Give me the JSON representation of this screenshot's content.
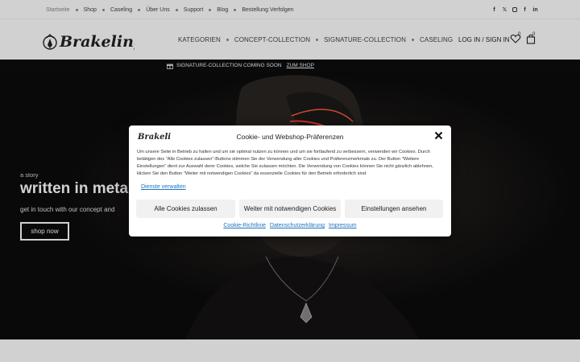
{
  "topbar": {
    "nav": [
      "Startseite",
      "Shop",
      "Caseling",
      "Über Uns",
      "Support",
      "Blog",
      "Bestellung Verfolgen"
    ],
    "social_icons": [
      "facebook-icon",
      "x-twitter-icon",
      "instagram-icon",
      "facebook-icon",
      "linkedin-icon"
    ]
  },
  "header": {
    "logo_text": "Brakeling",
    "nav": [
      "KATEGORIEN",
      "CONCEPT-COLLECTION",
      "SIGNATURE-COLLECTION",
      "CASELING"
    ],
    "login": "LOG IN / SIGN IN",
    "wishlist_count": "0",
    "cart_count": "0"
  },
  "announcement": {
    "text": "SIGNATURE-COLLECTION COMING SOON",
    "link": "ZUM SHOP"
  },
  "hero": {
    "eyebrow": "a story",
    "headline": "written in metal",
    "subline": "get in touch with our concept and",
    "button": "shop now"
  },
  "cookie_modal": {
    "logo_text": "Brakeling",
    "title": "Cookie- und Webshop-Präferenzen",
    "body": "Um unsere Seite in Betrieb zu halten und um sie optimal nutzen zu können und um sie fortlaufend zu verbessern, verwenden wir Cookies. Durch betätigen des \"Alle Cookies zulassen\"-Buttons stimmen Sie der Verwendung aller Cookies und Präferenzmerkmale zu. Der Button \"Weitere Einstellungen\" dient zur Auswahl derer Cookies, welche Sie zulassen möchten. Die Verwendung von Cookies können Sie nicht gänzlich ablehnen, klicken Sie den Button \"Weiter mit notwendigen Cookies\" da essenzielle Cookies für den Betrieb erforderlich sind.",
    "manage_link": "Dienste verwalten",
    "buttons": [
      "Alle Cookies zulassen",
      "Weiter mit notwendigen Cookies",
      "Einstellungen ansehen"
    ],
    "footer_links": [
      "Cookie-Richtlinie",
      "Datenschutzerklärung",
      "Impressum"
    ]
  },
  "colors": {
    "link": "#1e73be",
    "hero_bg": "#0b0b0b",
    "accent_red": "#ff3b2f"
  }
}
